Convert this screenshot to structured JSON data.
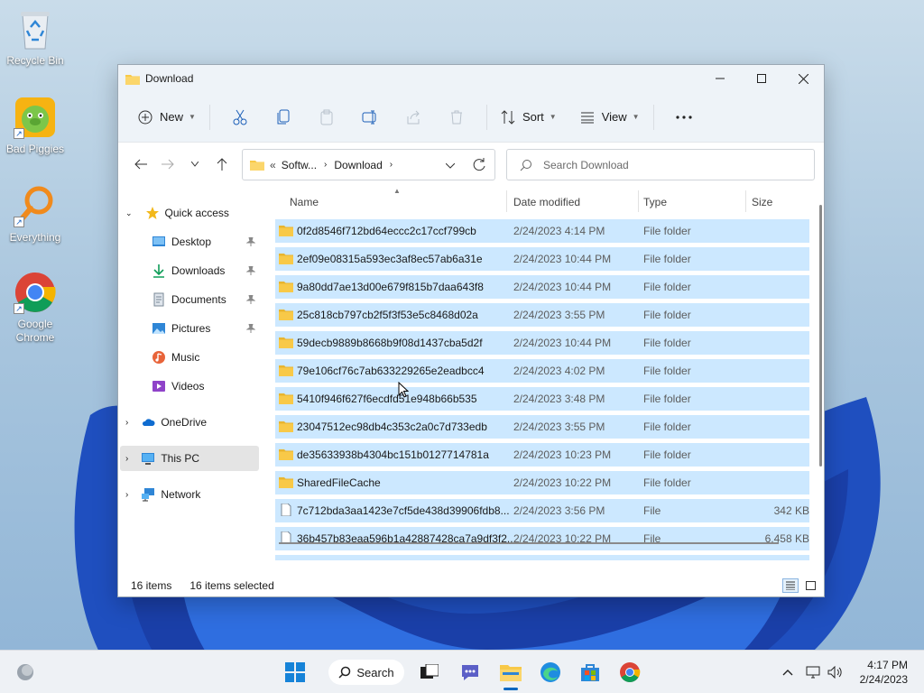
{
  "desktop": {
    "icons": [
      {
        "label": "Recycle Bin"
      },
      {
        "label": "Bad Piggies"
      },
      {
        "label": "Everything"
      },
      {
        "label": "Google Chrome"
      }
    ]
  },
  "window": {
    "title": "Download",
    "toolbar": {
      "new_label": "New",
      "sort_label": "Sort",
      "view_label": "View"
    },
    "address": {
      "prefix": "«",
      "crumbs": [
        "Softw...",
        "Download"
      ]
    },
    "search": {
      "placeholder": "Search Download"
    },
    "sidebar": {
      "quick_access": "Quick access",
      "items": [
        {
          "label": "Desktop",
          "pinned": true
        },
        {
          "label": "Downloads",
          "pinned": true
        },
        {
          "label": "Documents",
          "pinned": true
        },
        {
          "label": "Pictures",
          "pinned": true
        },
        {
          "label": "Music",
          "pinned": false
        },
        {
          "label": "Videos",
          "pinned": false
        }
      ],
      "onedrive": "OneDrive",
      "this_pc": "This PC",
      "network": "Network"
    },
    "columns": {
      "name": "Name",
      "date": "Date modified",
      "type": "Type",
      "size": "Size"
    },
    "rows": [
      {
        "name": "0f2d8546f712bd64eccc2c17ccf799cb",
        "date": "2/24/2023 4:14 PM",
        "type": "File folder",
        "size": "",
        "kind": "folder"
      },
      {
        "name": "2ef09e08315a593ec3af8ec57ab6a31e",
        "date": "2/24/2023 10:44 PM",
        "type": "File folder",
        "size": "",
        "kind": "folder"
      },
      {
        "name": "9a80dd7ae13d00e679f815b7daa643f8",
        "date": "2/24/2023 10:44 PM",
        "type": "File folder",
        "size": "",
        "kind": "folder"
      },
      {
        "name": "25c818cb797cb2f5f3f53e5c8468d02a",
        "date": "2/24/2023 3:55 PM",
        "type": "File folder",
        "size": "",
        "kind": "folder"
      },
      {
        "name": "59decb9889b8668b9f08d1437cba5d2f",
        "date": "2/24/2023 10:44 PM",
        "type": "File folder",
        "size": "",
        "kind": "folder"
      },
      {
        "name": "79e106cf76c7ab633229265e2eadbcc4",
        "date": "2/24/2023 4:02 PM",
        "type": "File folder",
        "size": "",
        "kind": "folder"
      },
      {
        "name": "5410f946f627f6ecdfd51e948b66b535",
        "date": "2/24/2023 3:48 PM",
        "type": "File folder",
        "size": "",
        "kind": "folder"
      },
      {
        "name": "23047512ec98db4c353c2a0c7d733edb",
        "date": "2/24/2023 3:55 PM",
        "type": "File folder",
        "size": "",
        "kind": "folder"
      },
      {
        "name": "de35633938b4304bc151b0127714781a",
        "date": "2/24/2023 10:23 PM",
        "type": "File folder",
        "size": "",
        "kind": "folder"
      },
      {
        "name": "SharedFileCache",
        "date": "2/24/2023 10:22 PM",
        "type": "File folder",
        "size": "",
        "kind": "folder"
      },
      {
        "name": "7c712bda3aa1423e7cf5de438d39906fdb8...",
        "date": "2/24/2023 3:56 PM",
        "type": "File",
        "size": "342 KB",
        "kind": "file"
      },
      {
        "name": "36b457b83eaa596b1a42887428ca7a9df3f2...",
        "date": "2/24/2023 10:22 PM",
        "type": "File",
        "size": "6,458 KB",
        "kind": "file"
      }
    ],
    "status": {
      "items": "16 items",
      "selected": "16 items selected"
    }
  },
  "taskbar": {
    "search_label": "Search",
    "time": "4:17 PM",
    "date": "2/24/2023"
  },
  "colors": {
    "selection": "#cce8ff",
    "folder": "#f8c948",
    "accent": "#0067c0"
  }
}
